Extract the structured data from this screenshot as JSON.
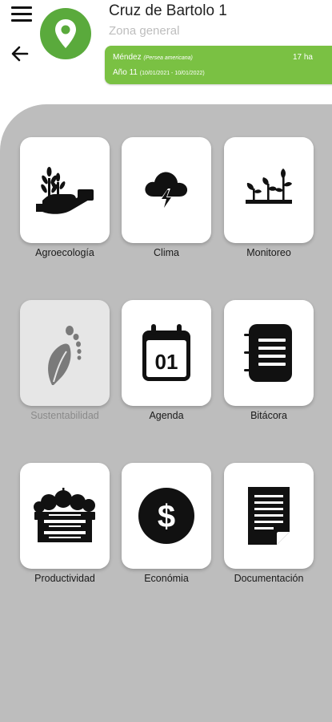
{
  "header": {
    "title": "Cruz de Bartolo 1",
    "subtitle": "Zona general",
    "icons": {
      "menu": "menu-icon",
      "back": "arrow-left-icon",
      "logo": "location-pin-icon"
    }
  },
  "info_card": {
    "crop": "Méndez",
    "crop_detail": "(Persea americana)",
    "area": "17 ha",
    "year": "Año 11",
    "period": "(10/01/2021 - 10/01/2022)"
  },
  "colors": {
    "brand_green": "#5aaa3c",
    "card_green": "#7ac143",
    "panel_grey": "#bdbdbd"
  },
  "modules": [
    {
      "label": "Agroecología",
      "icon": "hand-wheat-icon",
      "enabled": true
    },
    {
      "label": "Clima",
      "icon": "storm-cloud-icon",
      "enabled": true
    },
    {
      "label": "Monitoreo",
      "icon": "sprouts-icon",
      "enabled": true
    },
    {
      "label": "Sustentabilidad",
      "icon": "leaf-footprint-icon",
      "enabled": false
    },
    {
      "label": "Agenda",
      "icon": "calendar-icon",
      "enabled": true
    },
    {
      "label": "Bitácora",
      "icon": "notebook-icon",
      "enabled": true
    },
    {
      "label": "Productividad",
      "icon": "fruit-crate-icon",
      "enabled": true
    },
    {
      "label": "Económia",
      "icon": "dollar-coin-icon",
      "enabled": true
    },
    {
      "label": "Documentación",
      "icon": "document-icon",
      "enabled": true
    }
  ],
  "calendar_day": "01"
}
